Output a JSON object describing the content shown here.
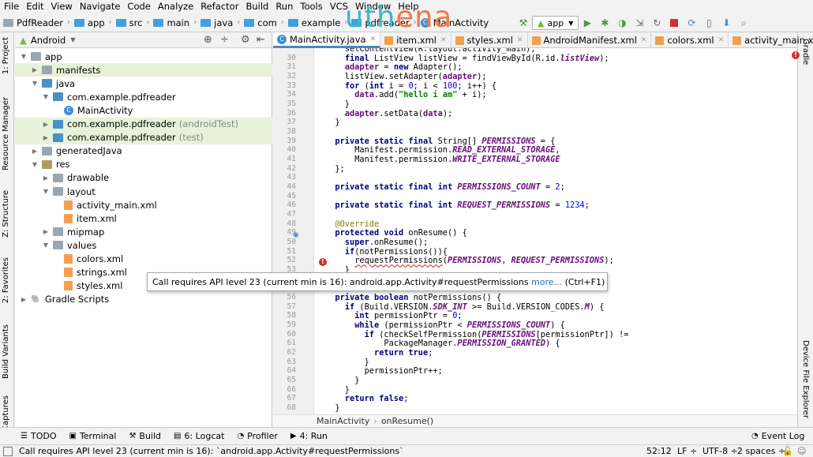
{
  "menu": [
    "File",
    "Edit",
    "View",
    "Navigate",
    "Code",
    "Analyze",
    "Refactor",
    "Build",
    "Run",
    "Tools",
    "VCS",
    "Window",
    "Help"
  ],
  "breadcrumb": [
    "PdfReader",
    "app",
    "src",
    "main",
    "java",
    "com",
    "example",
    "pdfreader",
    "MainActivity"
  ],
  "watermark": {
    "part1": "uth",
    "part2": "ena"
  },
  "run_config": "app",
  "left_tabs": [
    "1: Project",
    "Resource Manager",
    "Z: Structure",
    "2: Favorites",
    "Build Variants",
    "Captures"
  ],
  "right_tabs": [
    "Gradle",
    "Device File Explorer"
  ],
  "project": {
    "view": "Android",
    "tree": [
      {
        "label": "app",
        "suffix": "",
        "indent": 0,
        "icon": "fold",
        "open": true
      },
      {
        "label": "manifests",
        "suffix": "",
        "indent": 1,
        "icon": "fold",
        "open": false,
        "hl": true
      },
      {
        "label": "java",
        "suffix": "",
        "indent": 1,
        "icon": "fold",
        "open": true
      },
      {
        "label": "com.example.pdfreader",
        "suffix": "",
        "indent": 2,
        "icon": "fold",
        "open": true
      },
      {
        "label": "MainActivity",
        "suffix": "",
        "indent": 3,
        "icon": "class",
        "open": null
      },
      {
        "label": "com.example.pdfreader",
        "suffix": "(androidTest)",
        "indent": 2,
        "icon": "fold",
        "open": false,
        "hl": true
      },
      {
        "label": "com.example.pdfreader",
        "suffix": "(test)",
        "indent": 2,
        "icon": "fold",
        "open": false,
        "hl": true
      },
      {
        "label": "generatedJava",
        "suffix": "",
        "indent": 1,
        "icon": "fold",
        "open": false
      },
      {
        "label": "res",
        "suffix": "",
        "indent": 1,
        "icon": "res",
        "open": true
      },
      {
        "label": "drawable",
        "suffix": "",
        "indent": 2,
        "icon": "fold",
        "open": false
      },
      {
        "label": "layout",
        "suffix": "",
        "indent": 2,
        "icon": "fold",
        "open": true
      },
      {
        "label": "activity_main.xml",
        "suffix": "",
        "indent": 3,
        "icon": "xml",
        "open": null
      },
      {
        "label": "item.xml",
        "suffix": "",
        "indent": 3,
        "icon": "xml",
        "open": null
      },
      {
        "label": "mipmap",
        "suffix": "",
        "indent": 2,
        "icon": "fold",
        "open": false
      },
      {
        "label": "values",
        "suffix": "",
        "indent": 2,
        "icon": "fold",
        "open": true
      },
      {
        "label": "colors.xml",
        "suffix": "",
        "indent": 3,
        "icon": "xml",
        "open": null
      },
      {
        "label": "strings.xml",
        "suffix": "",
        "indent": 3,
        "icon": "xml",
        "open": null
      },
      {
        "label": "styles.xml",
        "suffix": "",
        "indent": 3,
        "icon": "xml",
        "open": null
      },
      {
        "label": "Gradle Scripts",
        "suffix": "",
        "indent": 0,
        "icon": "gradle",
        "open": false
      }
    ]
  },
  "tabs": [
    {
      "label": "MainActivity.java",
      "active": true,
      "color": "#3d8fd6"
    },
    {
      "label": "item.xml",
      "active": false,
      "color": "#f0a050"
    },
    {
      "label": "styles.xml",
      "active": false,
      "color": "#f0a050"
    },
    {
      "label": "AndroidManifest.xml",
      "active": false,
      "color": "#f0a050"
    },
    {
      "label": "colors.xml",
      "active": false,
      "color": "#f0a050"
    },
    {
      "label": "activity_main.xml",
      "active": false,
      "color": "#f0a050"
    }
  ],
  "code_lines": [
    {
      "n": "",
      "html": "    <span>setContentView(R.layout.activity_main);</span>"
    },
    {
      "n": "30",
      "html": "    <span class='kw'>final</span> ListView listView = findViewById(R.id.<span class='fd'>listView</span>);"
    },
    {
      "n": "31",
      "html": "    <span class='fd' style='font-style:normal;color:#660e7a'>adapter</span> = <span class='kw'>new</span> Adapter();"
    },
    {
      "n": "32",
      "html": "    listView.setAdapter(<span style='color:#660e7a;font-weight:bold'>adapter</span>);"
    },
    {
      "n": "33",
      "html": "    <span class='kw'>for</span> (<span class='kw'>int</span> i = <span class='nm'>0</span>; i &lt; <span class='nm'>100</span>; i++) {"
    },
    {
      "n": "34",
      "html": "      <span style='color:#660e7a;font-weight:bold'>data</span>.add(<span class='st'>\"hello i am\"</span> + i);"
    },
    {
      "n": "35",
      "html": "    }"
    },
    {
      "n": "36",
      "html": "    <span style='color:#660e7a;font-weight:bold'>adapter</span>.setData(<span style='color:#660e7a;font-weight:bold'>data</span>);"
    },
    {
      "n": "37",
      "html": "  }"
    },
    {
      "n": "38",
      "html": ""
    },
    {
      "n": "39",
      "html": "  <span class='kw'>private static final</span> String[] <span class='fd'>PERMISSIONS</span> = {"
    },
    {
      "n": "40",
      "html": "      Manifest.permission.<span class='fd'>READ_EXTERNAL_STORAGE</span>,"
    },
    {
      "n": "41",
      "html": "      Manifest.permission.<span class='fd'>WRITE_EXTERNAL_STORAGE</span>"
    },
    {
      "n": "42",
      "html": "  };"
    },
    {
      "n": "43",
      "html": ""
    },
    {
      "n": "44",
      "html": "  <span class='kw'>private static final int</span> <span class='fd'>PERMISSIONS_COUNT</span> = <span class='nm'>2</span>;"
    },
    {
      "n": "45",
      "html": ""
    },
    {
      "n": "46",
      "html": "  <span class='kw'>private static final int</span> <span class='fd'>REQUEST_PERMISSIONS</span> = <span class='nm'>1234</span>;"
    },
    {
      "n": "47",
      "html": ""
    },
    {
      "n": "48",
      "html": "  <span class='an'>@Override</span>"
    },
    {
      "n": "49",
      "html": "  <span class='kw'>protected void</span> onResume() {"
    },
    {
      "n": "50",
      "html": "    <span class='kw'>super</span>.onResume();"
    },
    {
      "n": "51",
      "html": "    <span class='kw'>if</span>(notPermissions()){"
    },
    {
      "n": "52",
      "html": "      <span style='text-decoration:underline wavy #d03030'>requestPermissions</span>(<span class='fd'>PERMISSIONS</span>, <span class='fd'>REQUEST_PERMISSIONS</span>);"
    },
    {
      "n": "53",
      "html": "    }"
    },
    {
      "n": "54",
      "html": ""
    },
    {
      "n": "55",
      "html": ""
    },
    {
      "n": "56",
      "html": "  <span class='kw'>private boolean</span> notPermissions() {"
    },
    {
      "n": "57",
      "html": "    <span class='kw'>if</span> (Build.VERSION.<span class='fd'>SDK_INT</span> &gt;= Build.VERSION_CODES.<span class='fd'>M</span>) {"
    },
    {
      "n": "58",
      "html": "      <span class='kw'>int</span> permissionPtr = <span class='nm'>0</span>;"
    },
    {
      "n": "59",
      "html": "      <span class='kw'>while</span> (permissionPtr &lt; <span class='fd'>PERMISSIONS_COUNT</span>) {"
    },
    {
      "n": "60",
      "html": "        <span class='kw'>if</span> (checkSelfPermission(<span class='fd'>PERMISSIONS</span>[permissionPtr]) !="
    },
    {
      "n": "61",
      "html": "            PackageManager.<span class='fd'>PERMISSION_GRANTED</span>) {"
    },
    {
      "n": "62",
      "html": "          <span class='kw'>return true</span>;"
    },
    {
      "n": "63",
      "html": "        }"
    },
    {
      "n": "64",
      "html": "        permissionPtr++;"
    },
    {
      "n": "65",
      "html": "      }"
    },
    {
      "n": "66",
      "html": "    }"
    },
    {
      "n": "67",
      "html": "    <span class='kw'>return false</span>;"
    },
    {
      "n": "68",
      "html": "  }"
    }
  ],
  "tooltip": {
    "message": "Call requires API level 23 (current min is 16):",
    "ref": "android.app.Activity#requestPermissions",
    "more": "more...",
    "shortcut": "(Ctrl+F1)"
  },
  "editor_breadcrumb": [
    "MainActivity",
    "onResume()"
  ],
  "bottom_tabs": [
    {
      "label": "TODO",
      "icon": "☰"
    },
    {
      "label": "Terminal",
      "icon": "▣"
    },
    {
      "label": "Build",
      "icon": "⚒"
    },
    {
      "label": "6: Logcat",
      "icon": "▤"
    },
    {
      "label": "Profiler",
      "icon": "◔"
    },
    {
      "label": "4: Run",
      "icon": "▶"
    }
  ],
  "event_log": "Event Log",
  "status": {
    "message": "Call requires API level 23 (current min is 16): `android.app.Activity#requestPermissions`",
    "position": "52:12",
    "line_sep": "LF",
    "encoding": "UTF-8",
    "indent": "2 spaces"
  }
}
